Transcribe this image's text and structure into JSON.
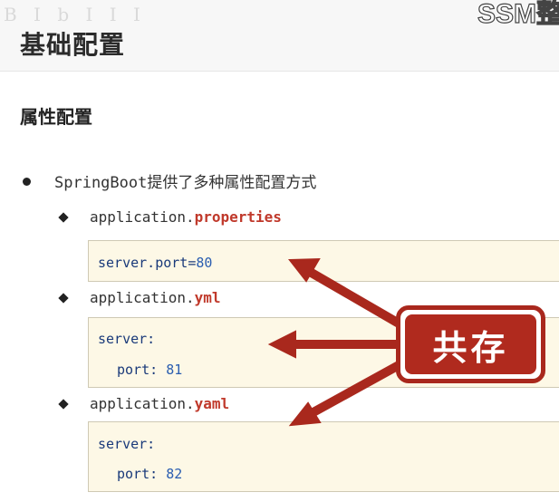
{
  "watermark": "B I b I I I",
  "corner_title": "SSM整",
  "page_title": "基础配置",
  "section_title": "属性配置",
  "bullet": "SpringBoot提供了多种属性配置方式",
  "files": [
    {
      "prefix": "application.",
      "ext": "properties",
      "lines": [
        {
          "key": "server.port=",
          "value": "80"
        }
      ]
    },
    {
      "prefix": "application.",
      "ext": "yml",
      "lines": [
        {
          "key": "server:",
          "value": ""
        },
        {
          "key": "port: ",
          "value": "81"
        }
      ]
    },
    {
      "prefix": "application.",
      "ext": "yaml",
      "lines": [
        {
          "key": "server:",
          "value": ""
        },
        {
          "key": "port: ",
          "value": "82"
        }
      ]
    }
  ],
  "badge": "共存",
  "colors": {
    "accent": "#b02a1e",
    "code_bg": "#fdf8e6",
    "keyword": "#1a3a7a",
    "number": "#2a5db0"
  }
}
